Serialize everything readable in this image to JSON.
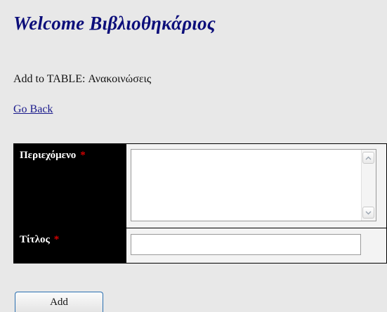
{
  "header": {
    "welcome": "Welcome Βιβλιοθηκάριος"
  },
  "content": {
    "subtitle": "Add to TABLE: Ανακοινώσεις",
    "back_link": "Go Back"
  },
  "form": {
    "required_marker": "*",
    "fields": [
      {
        "label": "Περιεχόμενο",
        "type": "textarea",
        "value": ""
      },
      {
        "label": "Τίτλος",
        "type": "text",
        "value": ""
      }
    ],
    "submit_label": "Add"
  },
  "colors": {
    "background": "#e8e8e8",
    "heading": "#0c0e7a",
    "link": "#1a1a8c",
    "label_bg": "#000000",
    "label_text": "#ffffff",
    "required": "#d10000",
    "button_border": "#2a6fb0"
  },
  "icons": {
    "scroll_up": "chevron-up-icon",
    "scroll_down": "chevron-down-icon"
  }
}
